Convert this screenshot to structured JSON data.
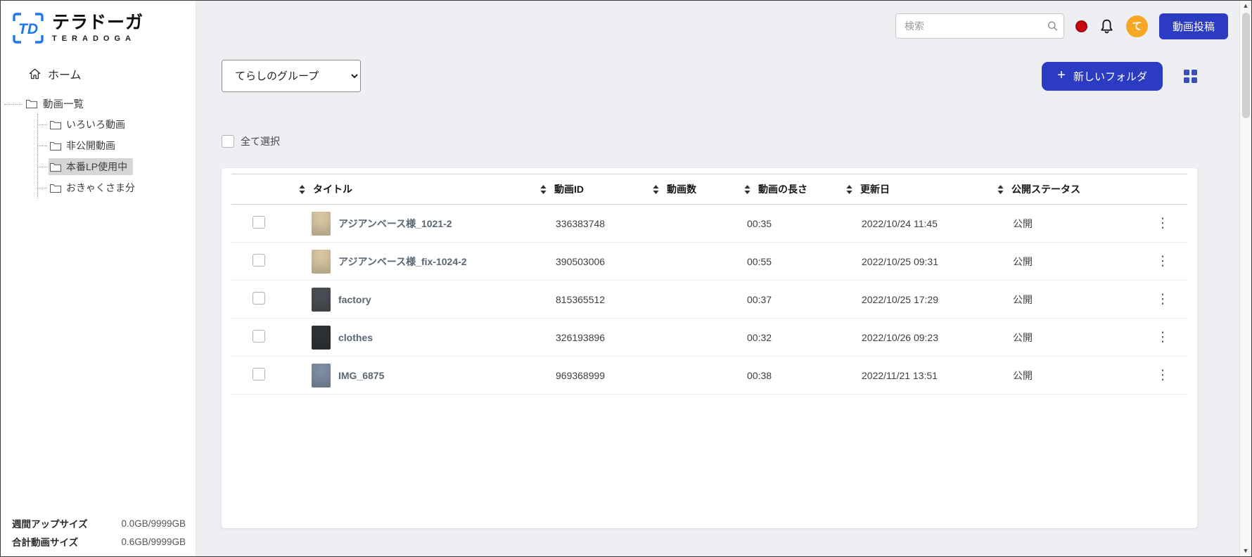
{
  "brand": {
    "logo": "TD",
    "name": "テラドーガ",
    "name_en": "TERADOGA"
  },
  "sidebar": {
    "home_label": "ホーム",
    "root_folder": "動画一覧",
    "folders": [
      {
        "label": "いろいろ動画",
        "selected": false
      },
      {
        "label": "非公開動画",
        "selected": false
      },
      {
        "label": "本番LP使用中",
        "selected": true
      },
      {
        "label": "おきゃくさま分",
        "selected": false
      }
    ],
    "storage": [
      {
        "label": "週間アップサイズ",
        "value": "0.0GB/9999GB"
      },
      {
        "label": "合計動画サイズ",
        "value": "0.6GB/9999GB"
      }
    ]
  },
  "topbar": {
    "search_placeholder": "検索",
    "avatar_text": "て",
    "upload_button": "動画投稿"
  },
  "toolbar": {
    "group_select_value": "てらしのグループ",
    "new_folder_button": "新しいフォルダ",
    "select_all_label": "全て選択"
  },
  "table": {
    "headers": [
      "タイトル",
      "動画ID",
      "動画数",
      "動画の長さ",
      "更新日",
      "公開ステータス"
    ],
    "rows": [
      {
        "title": "アジアンベース様_1021-2",
        "video_id": "336383748",
        "count": "",
        "duration": "00:35",
        "updated": "2022/10/24 11:45",
        "status": "公開",
        "thumb_color": "#d8c7a2"
      },
      {
        "title": "アジアンベース様_fix-1024-2",
        "video_id": "390503006",
        "count": "",
        "duration": "00:55",
        "updated": "2022/10/25 09:31",
        "status": "公開",
        "thumb_color": "#d8c7a2"
      },
      {
        "title": "factory",
        "video_id": "815365512",
        "count": "",
        "duration": "00:37",
        "updated": "2022/10/25 17:29",
        "status": "公開",
        "thumb_color": "#4a4f55"
      },
      {
        "title": "clothes",
        "video_id": "326193896",
        "count": "",
        "duration": "00:32",
        "updated": "2022/10/26 09:23",
        "status": "公開",
        "thumb_color": "#2f3338"
      },
      {
        "title": "IMG_6875",
        "video_id": "969368999",
        "count": "",
        "duration": "00:38",
        "updated": "2022/11/21 13:51",
        "status": "公開",
        "thumb_color": "#7e8fa3"
      }
    ]
  },
  "icons": {
    "plus": "+",
    "kebab": "⋮",
    "scroll_up": "▲",
    "scroll_down": "▼"
  },
  "colors": {
    "primary_blue": "#2b3bc2",
    "logo_blue": "#1f76e8",
    "avatar_orange": "#f6a723",
    "record_red": "#c9080d"
  }
}
